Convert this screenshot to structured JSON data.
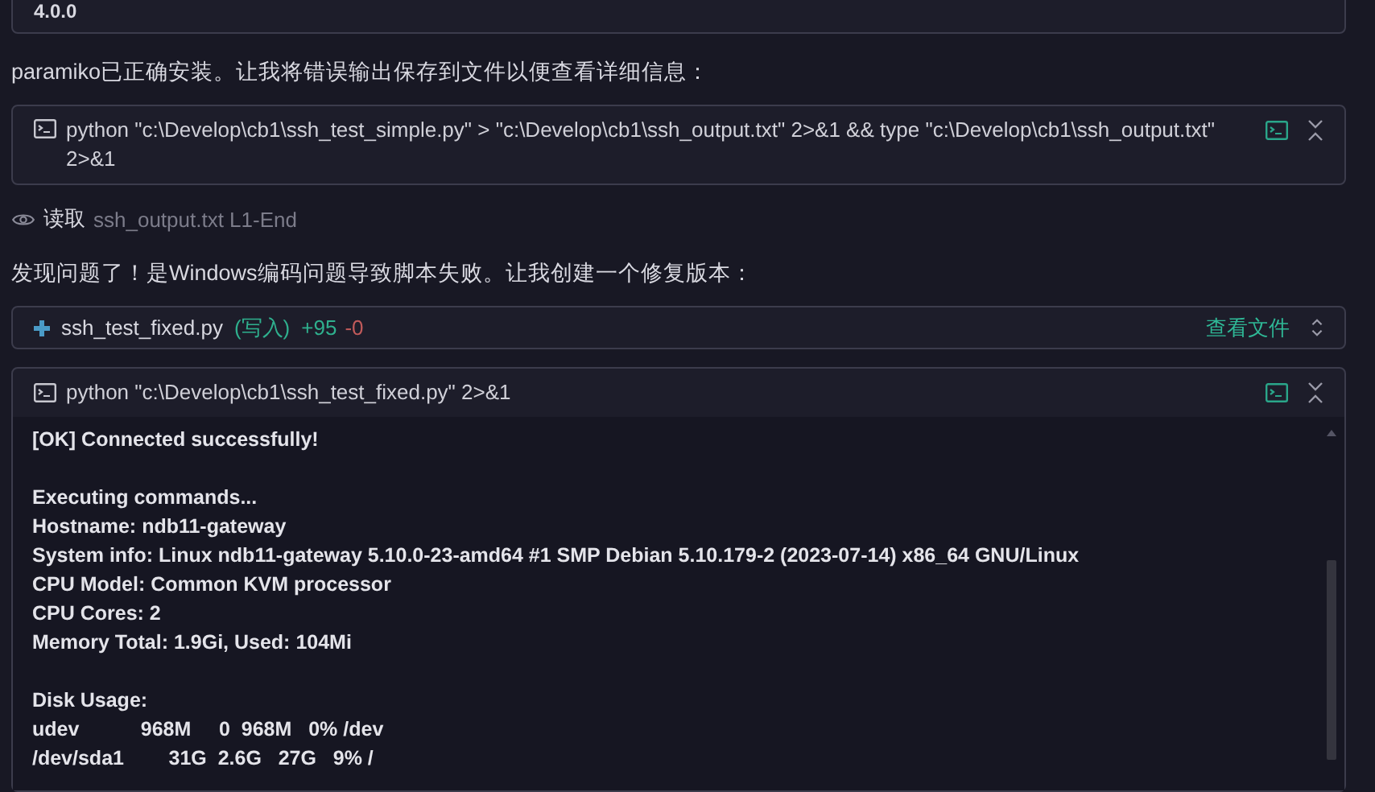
{
  "previous_output": {
    "text": "4.0.0"
  },
  "messages": [
    {
      "text": "paramiko已正确安装。让我将错误输出保存到文件以便查看详细信息："
    }
  ],
  "command_card": {
    "command": "python \"c:\\Develop\\cb1\\ssh_test_simple.py\" > \"c:\\Develop\\cb1\\ssh_output.txt\" 2>&1 && type \"c:\\Develop\\cb1\\ssh_output.txt\" 2>&1"
  },
  "read_step": {
    "action": "读取",
    "file": "ssh_output.txt L1-End"
  },
  "message_2": {
    "text": "发现问题了！是Windows编码问题导致脚本失败。让我创建一个修复版本："
  },
  "file_card": {
    "filename": "ssh_test_fixed.py",
    "mode": "(写入)",
    "added": "+95",
    "removed": "-0",
    "link": "查看文件"
  },
  "terminal_card": {
    "command": "python \"c:\\Develop\\cb1\\ssh_test_fixed.py\" 2>&1",
    "output_blocks": [
      [
        "[OK] Connected successfully!"
      ],
      [
        "Executing commands...",
        "Hostname: ndb11-gateway",
        "System info: Linux ndb11-gateway 5.10.0-23-amd64 #1 SMP Debian 5.10.179-2 (2023-07-14) x86_64 GNU/Linux",
        "CPU Model: Common KVM processor",
        "CPU Cores: 2",
        "Memory Total: 1.9Gi, Used: 104Mi"
      ],
      [
        "Disk Usage:",
        "udev           968M     0  968M   0% /dev",
        "/dev/sda1        31G  2.6G   27G   9% /"
      ]
    ]
  }
}
